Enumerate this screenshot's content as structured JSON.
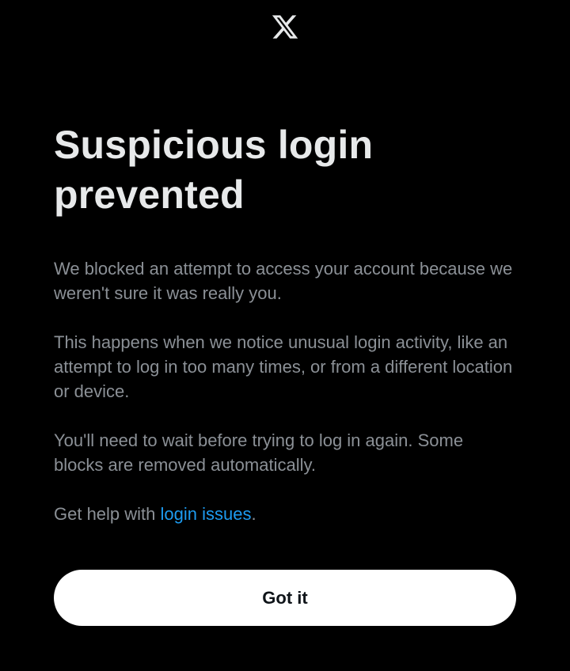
{
  "brand": {
    "logo_icon": "x-logo-icon",
    "background": "#000000",
    "accent": "#1d9bf0"
  },
  "title": "Suspicious login prevented",
  "paragraphs": {
    "p1": "We blocked an attempt to access your account because we weren't sure it was really you.",
    "p2": "This happens when we notice unusual login activity, like an attempt to log in too many times, or from a different location or device.",
    "p3": "You'll need to wait before trying to log in again. Some blocks are removed automatically."
  },
  "help": {
    "prefix": "Get help with ",
    "link_label": "login issues",
    "suffix": "."
  },
  "button": {
    "label": "Got it"
  }
}
